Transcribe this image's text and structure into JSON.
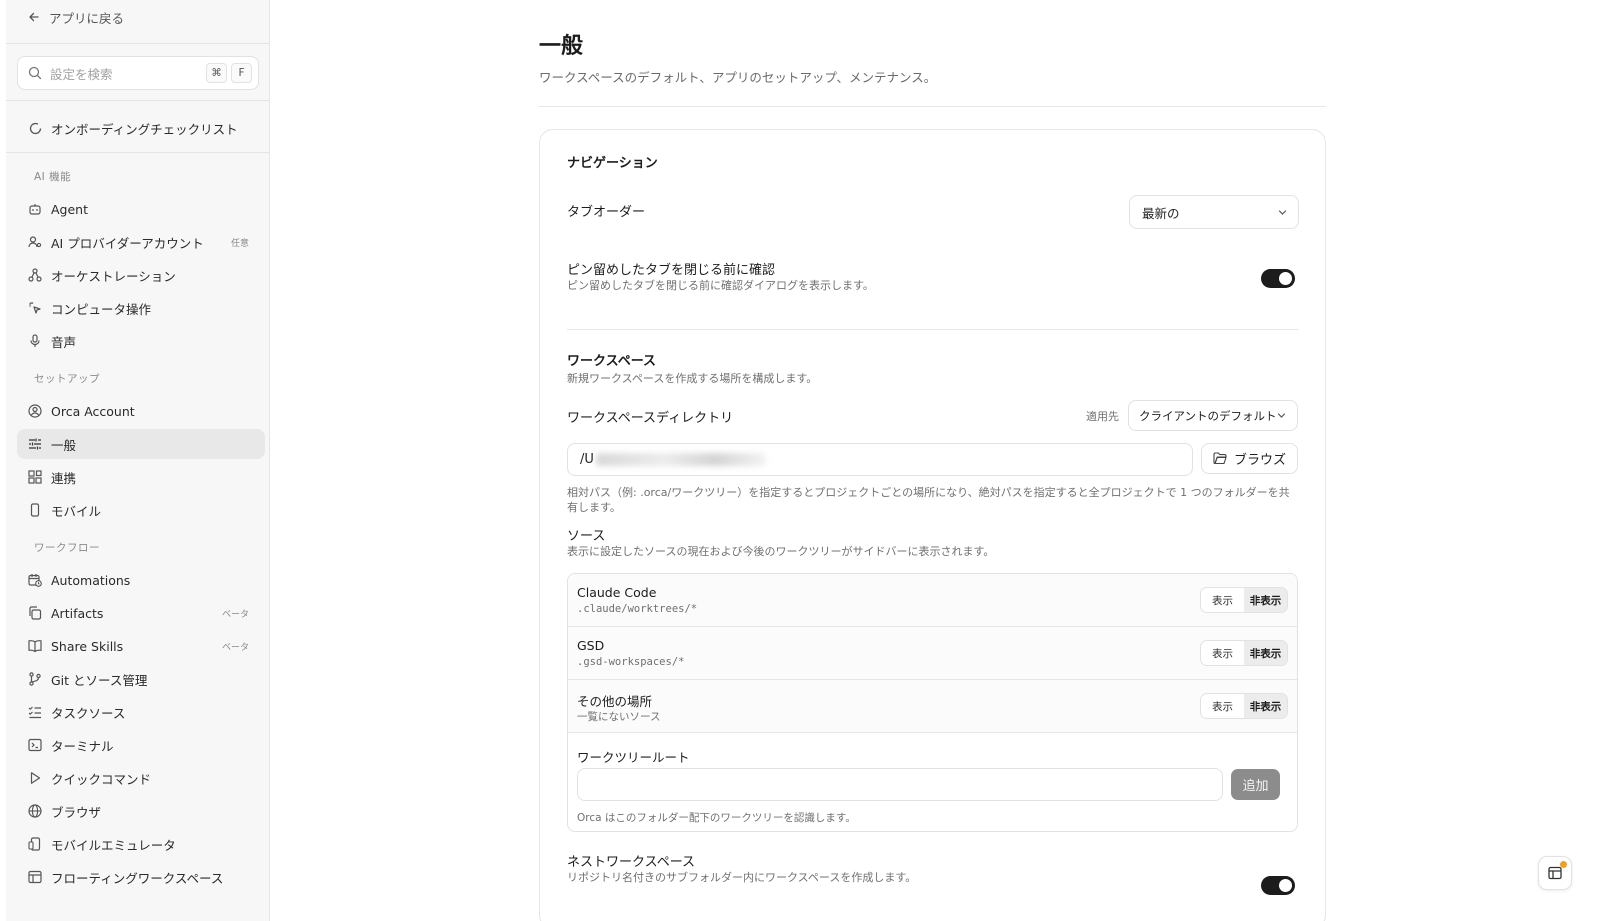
{
  "sidebar": {
    "back_label": "アプリに戻る",
    "search_placeholder": "設定を検索",
    "search_shortcut": [
      "⌘",
      "F"
    ],
    "onboarding_label": "オンボーディングチェックリスト",
    "sections": {
      "ai": "AI 機能",
      "setup": "セットアップ",
      "workflow": "ワークフロー"
    },
    "ai_items": [
      {
        "label": "Agent",
        "icon": "robot-icon"
      },
      {
        "label": "AI プロバイダーアカウント",
        "icon": "user-key-icon",
        "badge": "任意"
      },
      {
        "label": "オーケストレーション",
        "icon": "orchestration-icon"
      },
      {
        "label": "コンピュータ操作",
        "icon": "pointer-click-icon"
      },
      {
        "label": "音声",
        "icon": "microphone-icon"
      }
    ],
    "setup_items": [
      {
        "label": "Orca Account",
        "icon": "user-circle-icon"
      },
      {
        "label": "一般",
        "icon": "sliders-icon",
        "active": true
      },
      {
        "label": "連携",
        "icon": "blocks-icon"
      },
      {
        "label": "モバイル",
        "icon": "smartphone-icon"
      }
    ],
    "workflow_items": [
      {
        "label": "Automations",
        "icon": "calendar-clock-icon"
      },
      {
        "label": "Artifacts",
        "icon": "copy-icon",
        "badge": "ベータ"
      },
      {
        "label": "Share Skills",
        "icon": "book-icon",
        "badge": "ベータ"
      },
      {
        "label": "Git とソース管理",
        "icon": "git-branch-icon"
      },
      {
        "label": "タスクソース",
        "icon": "list-checks-icon"
      },
      {
        "label": "ターミナル",
        "icon": "terminal-icon"
      },
      {
        "label": "クイックコマンド",
        "icon": "play-icon"
      },
      {
        "label": "ブラウザ",
        "icon": "globe-icon"
      },
      {
        "label": "モバイルエミュレータ",
        "icon": "device-icon"
      },
      {
        "label": "フローティングワークスペース",
        "icon": "layout-icon"
      }
    ]
  },
  "page": {
    "title": "一般",
    "subtitle": "ワークスペースのデフォルト、アプリのセットアップ、メンテナンス。"
  },
  "navigation": {
    "heading": "ナビゲーション",
    "tab_order_label": "タブオーダー",
    "tab_order_value": "最新の",
    "pin_confirm_label": "ピン留めしたタブを閉じる前に確認",
    "pin_confirm_desc": "ピン留めしたタブを閉じる前に確認ダイアログを表示します。",
    "pin_confirm_on": true
  },
  "workspace": {
    "heading": "ワークスペース",
    "desc": "新規ワークスペースを作成する場所を構成します。",
    "dir_label": "ワークスペースディレクトリ",
    "apply_label": "適用先",
    "apply_value": "クライアントのデフォルト",
    "dir_value_prefix": "/U",
    "browse_label": "ブラウズ",
    "dir_help": "相対パス（例: .orca/ワークツリー）を指定するとプロジェクトごとの場所になり、絶対パスを指定すると全プロジェクトで 1 つのフォルダーを共有します。",
    "sources_heading": "ソース",
    "sources_desc": "表示に設定したソースの現在および今後のワークツリーがサイドバーに表示されます。",
    "show_label": "表示",
    "hide_label": "非表示",
    "sources": [
      {
        "name": "Claude Code",
        "path": ".claude/worktrees/*",
        "selected": "非表示"
      },
      {
        "name": "GSD",
        "path": ".gsd-workspaces/*",
        "selected": "非表示"
      },
      {
        "name": "その他の場所",
        "path": "一覧にないソース",
        "selected": "非表示"
      }
    ],
    "root_label": "ワークツリールート",
    "root_value": "",
    "add_label": "追加",
    "root_help": "Orca はこのフォルダー配下のワークツリーを認識します。",
    "nested_label": "ネストワークスペース",
    "nested_desc": "リポジトリ名付きのサブフォルダー内にワークスペースを作成します。",
    "nested_on": true
  },
  "colors": {
    "accent": "#1c1c1c",
    "notify_dot": "#f0a020"
  }
}
